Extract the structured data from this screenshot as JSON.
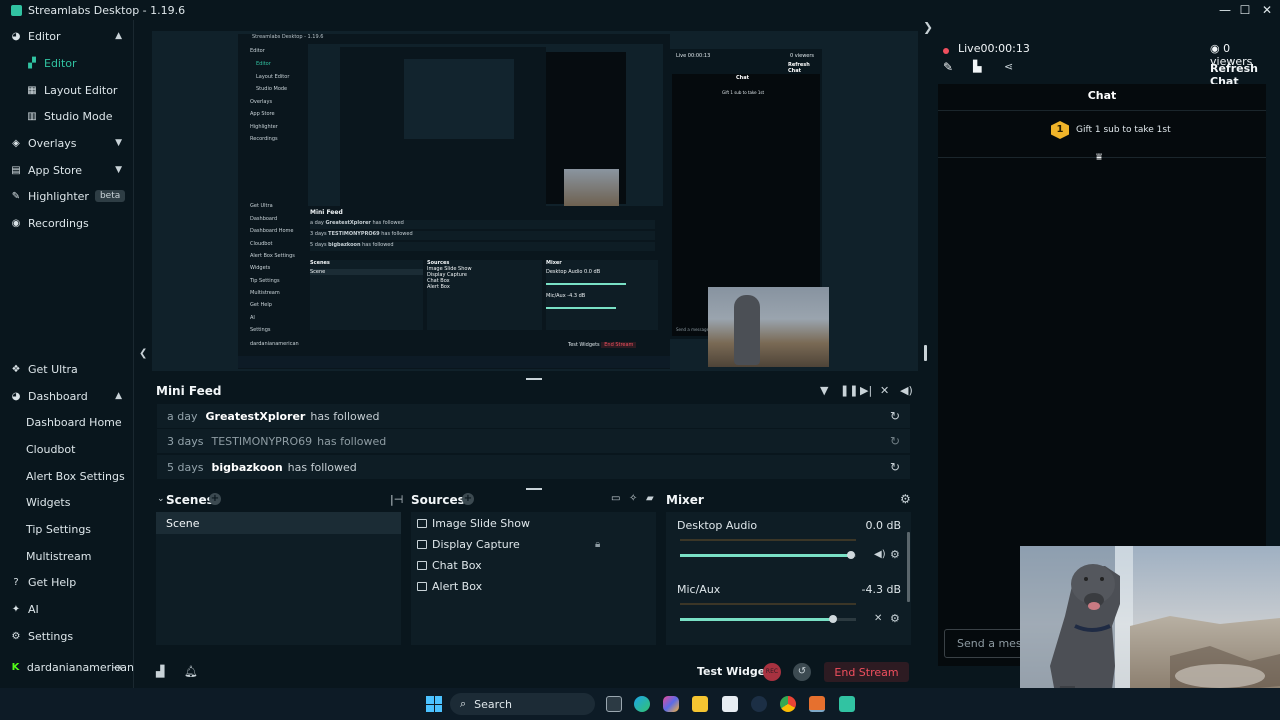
{
  "window": {
    "title": "Streamlabs Desktop - 1.19.6"
  },
  "sidebar": {
    "editor": "Editor",
    "editor_sub": [
      "Editor",
      "Layout Editor",
      "Studio Mode"
    ],
    "overlays": "Overlays",
    "app_store": "App Store",
    "highlighter": "Highlighter",
    "highlighter_badge": "beta",
    "recordings": "Recordings",
    "get_ultra": "Get Ultra",
    "dashboard": "Dashboard",
    "dashboard_sub": [
      "Dashboard Home",
      "Cloudbot",
      "Alert Box Settings",
      "Widgets",
      "Tip Settings",
      "Multistream"
    ],
    "get_help": "Get Help",
    "ai": "AI",
    "settings": "Settings",
    "user": "dardanianamerican"
  },
  "minifeed": {
    "title": "Mini Feed",
    "rows": [
      {
        "when": "a day",
        "who": "GreatestXplorer",
        "what": "has followed"
      },
      {
        "when": "3 days",
        "who": "TESTIMONYPRO69",
        "what": "has followed"
      },
      {
        "when": "5 days",
        "who": "bigbazkoon",
        "what": "has followed"
      }
    ]
  },
  "scenes": {
    "title": "Scenes",
    "items": [
      "Scene"
    ]
  },
  "sources": {
    "title": "Sources",
    "items": [
      "Image Slide Show",
      "Display Capture",
      "Chat Box",
      "Alert Box"
    ]
  },
  "mixer": {
    "title": "Mixer",
    "channels": [
      {
        "name": "Desktop Audio",
        "level": "0.0 dB",
        "volume": 0.97
      },
      {
        "name": "Mic/Aux",
        "level": "-4.3 dB",
        "volume": 0.87
      }
    ]
  },
  "footer": {
    "test_widgets": "Test Widgets",
    "end_stream": "End Stream",
    "rec_label": "REC"
  },
  "live": {
    "status": "Live",
    "timer": "00:00:13",
    "viewers": "0 viewers",
    "refresh_chat": "Refresh Chat"
  },
  "chat": {
    "title": "Chat",
    "pinned_badge": "1",
    "pinned_text": "Gift 1 sub to take 1st",
    "input_placeholder": "Send a message"
  },
  "nested": {
    "title": "Streamlabs Desktop - 1.19.6",
    "minifeed_title": "Mini Feed",
    "sidebar_items": [
      "Editor",
      "Editor",
      "Layout Editor",
      "Studio Mode",
      "Overlays",
      "App Store",
      "Highlighter",
      "Recordings",
      "Get Ultra",
      "Dashboard",
      "Dashboard Home",
      "Cloudbot",
      "Alert Box Settings",
      "Widgets",
      "Tip Settings",
      "Multistream",
      "Get Help",
      "AI",
      "Settings",
      "dardanianamerican"
    ],
    "feed": [
      {
        "when": "a day",
        "who": "GreatestXplorer",
        "what": "has followed"
      },
      {
        "when": "3 days",
        "who": "TESTIMONYPRO69",
        "what": "has followed"
      },
      {
        "when": "5 days",
        "who": "bigbazkoon",
        "what": "has followed"
      }
    ],
    "scenes": "Scenes",
    "scene_item": "Scene",
    "sources": "Sources",
    "source_items": [
      "Image Slide Show",
      "Display Capture",
      "Chat Box",
      "Alert Box"
    ],
    "mixer": "Mixer",
    "desktop_audio": "Desktop Audio",
    "desktop_level": "0.0 dB",
    "mic": "Mic/Aux",
    "mic_level": "-4.3 dB",
    "live": "Live 00:00:13",
    "viewers": "0 viewers",
    "refresh": "Refresh Chat",
    "chat": "Chat",
    "gift": "Gift 1 sub to take 1st",
    "send": "Send a message",
    "test_widgets": "Test Widgets",
    "end_stream": "End Stream"
  },
  "taskbar": {
    "search": "Search"
  },
  "colors": {
    "accent": "#31c3a2",
    "live_red": "#f04f5e",
    "bg": "#09161d",
    "panel": "#0e1d25"
  }
}
